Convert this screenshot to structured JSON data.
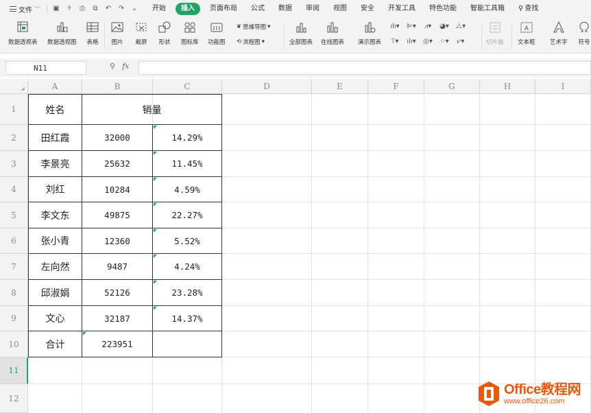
{
  "menubar": {
    "file_label": "文件",
    "tabs": [
      "开始",
      "插入",
      "页面布局",
      "公式",
      "数据",
      "审阅",
      "视图",
      "安全",
      "开发工具",
      "特色功能",
      "智能工具箱"
    ],
    "active_tab": "插入",
    "search_label": "查找"
  },
  "ribbon": {
    "pivot_table": "数据透视表",
    "pivot_chart": "数据透视图",
    "table": "表格",
    "picture": "图片",
    "screenshot": "截屏",
    "shapes": "形状",
    "icon_library": "图标库",
    "function_chart": "功能图",
    "mindmap": "思维导图",
    "flowchart": "流程图",
    "all_charts": "全部图表",
    "online_charts": "在线图表",
    "demo_chart": "演示图表",
    "slicer": "切片器",
    "textbox": "文本框",
    "wordart": "艺术字",
    "symbol": "符号"
  },
  "formula_bar": {
    "cell_ref": "N11",
    "fx_label": "fx",
    "formula": ""
  },
  "sheet": {
    "column_headers": [
      "A",
      "B",
      "C",
      "D",
      "E",
      "F",
      "G",
      "H",
      "I"
    ],
    "row_headers": [
      "1",
      "2",
      "3",
      "4",
      "5",
      "6",
      "7",
      "8",
      "9",
      "10",
      "11",
      "12"
    ],
    "selected_row": "11",
    "header_row": {
      "name": "姓名",
      "sales": "销量"
    },
    "rows": [
      {
        "name": "田红霞",
        "sales": "32000",
        "pct": "14.29%"
      },
      {
        "name": "李景亮",
        "sales": "25632",
        "pct": "11.45%"
      },
      {
        "name": "刘红",
        "sales": "10284",
        "pct": "4.59%"
      },
      {
        "name": "李文东",
        "sales": "49875",
        "pct": "22.27%"
      },
      {
        "name": "张小青",
        "sales": "12360",
        "pct": "5.52%"
      },
      {
        "name": "左向然",
        "sales": "9487",
        "pct": "4.24%"
      },
      {
        "name": "邱淑娟",
        "sales": "52126",
        "pct": "23.28%"
      },
      {
        "name": "文心",
        "sales": "32187",
        "pct": "14.37%"
      }
    ],
    "total_row": {
      "name": "合计",
      "sales": "223951"
    }
  },
  "watermark": {
    "brand": "Office教程网",
    "url": "www.office26.com"
  },
  "colors": {
    "accent_green": "#21a366",
    "watermark_orange": "#e8590c"
  }
}
